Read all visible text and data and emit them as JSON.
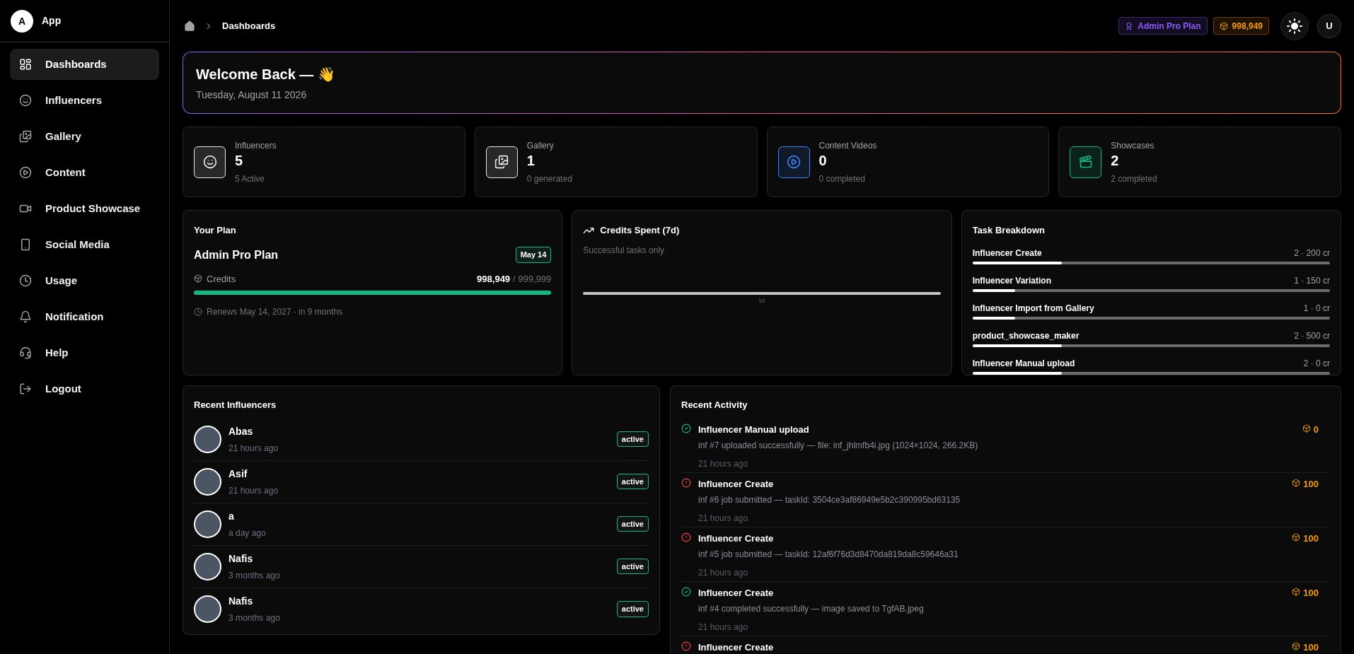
{
  "app": {
    "logo_letter": "A",
    "name": "App"
  },
  "sidebar": {
    "items": [
      {
        "label": "Dashboards",
        "selected": true
      },
      {
        "label": "Influencers",
        "selected": false
      },
      {
        "label": "Gallery",
        "selected": false
      },
      {
        "label": "Content",
        "selected": false
      },
      {
        "label": "Product Showcase",
        "selected": false
      },
      {
        "label": "Social Media",
        "selected": false
      },
      {
        "label": "Usage",
        "selected": false
      },
      {
        "label": "Notification",
        "selected": false
      },
      {
        "label": "Help",
        "selected": false
      },
      {
        "label": "Logout",
        "selected": false
      }
    ]
  },
  "breadcrumb": {
    "current": "Dashboards"
  },
  "header": {
    "plan_badge": "Admin Pro Plan",
    "credits_badge": "998,949",
    "user_initial": "U"
  },
  "welcome": {
    "title": "Welcome Back — 👋",
    "date": "Tuesday, August 11 2026"
  },
  "stats": [
    {
      "label": "Influencers",
      "value": "5",
      "sub": "5 Active",
      "color": "#e5e7eb"
    },
    {
      "label": "Gallery",
      "value": "1",
      "sub": "0 generated",
      "color": "#e5e7eb"
    },
    {
      "label": "Content Videos",
      "value": "0",
      "sub": "0 completed",
      "color": "#3b82f6"
    },
    {
      "label": "Showcases",
      "value": "2",
      "sub": "2 completed",
      "color": "#10b981"
    }
  ],
  "plan": {
    "heading": "Your Plan",
    "name": "Admin Pro Plan",
    "date_badge": "May 14",
    "credits_label": "Credits",
    "used": "998,949",
    "total": "/ 999,999",
    "level": 0.999,
    "renews": "Renews May 14, 2027 · in 9 months"
  },
  "credits_chart": {
    "title": "Credits Spent (7d)",
    "subtitle": "Successful tasks only",
    "x_label": "10"
  },
  "task_breakdown": {
    "title": "Task Breakdown",
    "tasks": [
      {
        "name": "Influencer Create",
        "value": "2 · 200 cr",
        "level": 0.25
      },
      {
        "name": "Influencer Variation",
        "value": "1 · 150 cr",
        "level": 0.12
      },
      {
        "name": "Influencer Import from Gallery",
        "value": "1 · 0 cr",
        "level": 0.12
      },
      {
        "name": "product_showcase_maker",
        "value": "2 · 500 cr",
        "level": 0.25
      },
      {
        "name": "Influencer Manual upload",
        "value": "2 · 0 cr",
        "level": 0.25
      }
    ]
  },
  "recent_influencers": {
    "title": "Recent Influencers",
    "items": [
      {
        "name": "Abas",
        "time": "21 hours ago",
        "status": "active"
      },
      {
        "name": "Asif",
        "time": "21 hours ago",
        "status": "active"
      },
      {
        "name": "a",
        "time": "a day ago",
        "status": "active"
      },
      {
        "name": "Nafis",
        "time": "3 months ago",
        "status": "active"
      },
      {
        "name": "Nafis",
        "time": "3 months ago",
        "status": "active"
      }
    ]
  },
  "recent_activity": {
    "title": "Recent Activity",
    "items": [
      {
        "kind": "success",
        "title": "Influencer Manual upload",
        "detail": "inf #7 uploaded successfully — file: inf_jhlmfb4i.jpg (1024×1024, 266.2KB)",
        "time": "21 hours ago",
        "credits": "0"
      },
      {
        "kind": "error",
        "title": "Influencer Create",
        "detail": "inf #6 job submitted — taskId: 3504ce3af86949e5b2c390995bd63135",
        "time": "21 hours ago",
        "credits": "100"
      },
      {
        "kind": "error",
        "title": "Influencer Create",
        "detail": "inf #5 job submitted — taskId: 12af6f76d3d8470da819da8c59646a31",
        "time": "21 hours ago",
        "credits": "100"
      },
      {
        "kind": "success",
        "title": "Influencer Create",
        "detail": "inf #4 completed successfully — image saved to TgfAB.jpeg",
        "time": "21 hours ago",
        "credits": "100"
      },
      {
        "kind": "error",
        "title": "Influencer Create",
        "credits": "100"
      }
    ]
  }
}
